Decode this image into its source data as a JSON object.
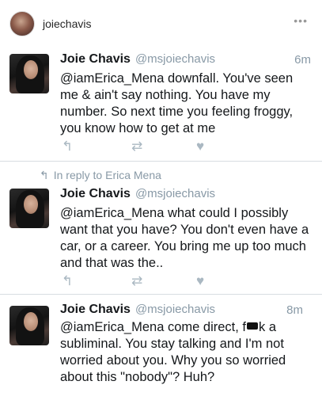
{
  "instagram": {
    "username": "joiechavis",
    "more_icon": "more-dots-icon"
  },
  "tweets": [
    {
      "name": "Joie Chavis",
      "handle": "@msjoiechavis",
      "time": "6m",
      "text": "@iamErica_Mena downfall. You've seen me & ain't say nothing. You have my number. So next time you feeling froggy, you know how to get at me"
    },
    {
      "reply_context": "In reply to Erica Mena",
      "name": "Joie Chavis",
      "handle": "@msjoiechavis",
      "time": "",
      "text": "@iamErica_Mena what could I possibly want that you have? You don't even have a car, or a career. You bring me up too much and that was the.."
    },
    {
      "name": "Joie Chavis",
      "handle": "@msjoiechavis",
      "time": "8m",
      "text_before_censor": "@iamErica_Mena come direct, f",
      "text_after_censor": "k a subliminal. You stay talking and I'm not worried about you. Why you so worried about this \"nobody\"? Huh?"
    }
  ],
  "icons": {
    "reply": "reply-icon",
    "retweet": "retweet-icon",
    "like": "heart-icon"
  },
  "colors": {
    "muted": "#8899a6",
    "action": "#aab8c2",
    "text": "#14171a"
  }
}
